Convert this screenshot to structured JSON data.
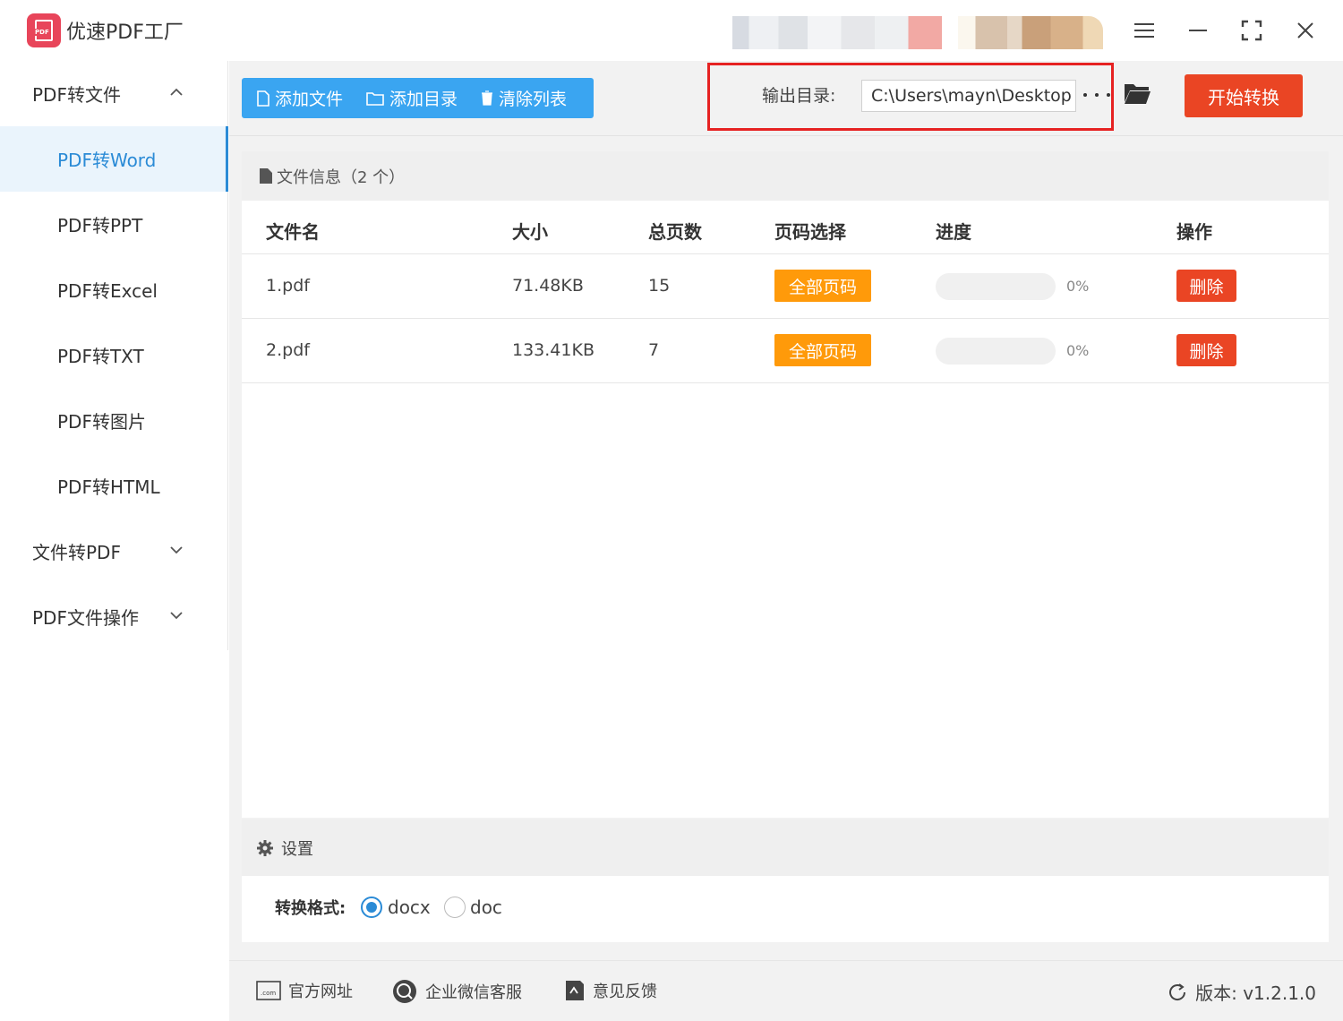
{
  "app": {
    "title": "优速PDF工厂",
    "logo_text": "PDF"
  },
  "sidebar": {
    "groups": [
      {
        "label": "PDF转文件",
        "expanded": true
      },
      {
        "label": "文件转PDF",
        "expanded": false
      },
      {
        "label": "PDF文件操作",
        "expanded": false
      }
    ],
    "items": [
      {
        "label": "PDF转Word",
        "active": true
      },
      {
        "label": "PDF转PPT"
      },
      {
        "label": "PDF转Excel"
      },
      {
        "label": "PDF转TXT"
      },
      {
        "label": "PDF转图片"
      },
      {
        "label": "PDF转HTML"
      }
    ]
  },
  "toolbar": {
    "add_file": "添加文件",
    "add_dir": "添加目录",
    "clear_list": "清除列表",
    "output_label": "输出目录:",
    "output_path": "C:\\Users\\mayn\\Desktop",
    "start": "开始转换"
  },
  "files": {
    "header": "文件信息（2 个）",
    "columns": {
      "name": "文件名",
      "size": "大小",
      "pages": "总页数",
      "page_select": "页码选择",
      "progress": "进度",
      "action": "操作"
    },
    "rows": [
      {
        "name": "1.pdf",
        "size": "71.48KB",
        "pages": "15",
        "page_select": "全部页码",
        "progress": 0,
        "progress_text": "0%",
        "action": "删除"
      },
      {
        "name": "2.pdf",
        "size": "133.41KB",
        "pages": "7",
        "page_select": "全部页码",
        "progress": 0,
        "progress_text": "0%",
        "action": "删除"
      }
    ]
  },
  "settings": {
    "title": "设置",
    "format_label": "转换格式:",
    "options": [
      {
        "label": "docx",
        "selected": true
      },
      {
        "label": "doc",
        "selected": false
      }
    ]
  },
  "footer": {
    "website": "官方网址",
    "wechat": "企业微信客服",
    "feedback": "意见反馈",
    "version": "版本: v1.2.1.0"
  },
  "colors": {
    "accent": "#2b8bd6",
    "toolbar": "#3aa5f1",
    "danger": "#ea4524",
    "warning": "#ff9a0a",
    "highlight_box": "#e62222"
  }
}
